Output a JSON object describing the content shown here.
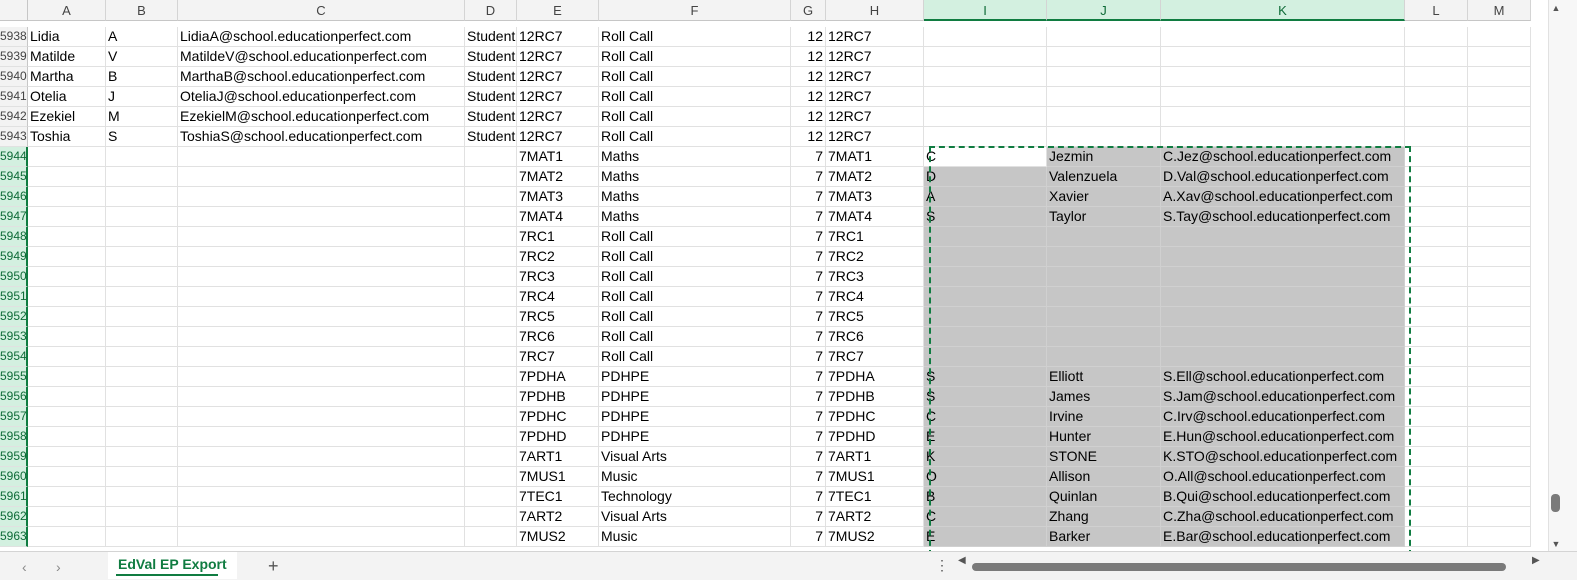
{
  "columns": [
    {
      "letter": "A",
      "width": 78
    },
    {
      "letter": "B",
      "width": 72
    },
    {
      "letter": "C",
      "width": 287
    },
    {
      "letter": "D",
      "width": 52
    },
    {
      "letter": "E",
      "width": 82
    },
    {
      "letter": "F",
      "width": 192
    },
    {
      "letter": "G",
      "width": 35
    },
    {
      "letter": "H",
      "width": 98
    },
    {
      "letter": "I",
      "width": 123
    },
    {
      "letter": "J",
      "width": 114
    },
    {
      "letter": "K",
      "width": 244
    },
    {
      "letter": "L",
      "width": 63
    },
    {
      "letter": "M",
      "width": 63
    }
  ],
  "selected_columns": [
    "I",
    "J",
    "K"
  ],
  "rows": [
    {
      "num": "5938",
      "A": "Lidia",
      "B": "A",
      "C": "LidiaA@school.educationperfect.com",
      "D": "Student",
      "E": "12RC7",
      "F": "Roll Call",
      "G": "12",
      "H": "12RC7",
      "I": "",
      "J": "",
      "K": ""
    },
    {
      "num": "5939",
      "A": "Matilde",
      "B": "V",
      "C": "MatildeV@school.educationperfect.com",
      "D": "Student",
      "E": "12RC7",
      "F": "Roll Call",
      "G": "12",
      "H": "12RC7",
      "I": "",
      "J": "",
      "K": ""
    },
    {
      "num": "5940",
      "A": "Martha",
      "B": "B",
      "C": "MarthaB@school.educationperfect.com",
      "D": "Student",
      "E": "12RC7",
      "F": "Roll Call",
      "G": "12",
      "H": "12RC7",
      "I": "",
      "J": "",
      "K": ""
    },
    {
      "num": "5941",
      "A": "Otelia",
      "B": "J",
      "C": "OteliaJ@school.educationperfect.com",
      "D": "Student",
      "E": "12RC7",
      "F": "Roll Call",
      "G": "12",
      "H": "12RC7",
      "I": "",
      "J": "",
      "K": ""
    },
    {
      "num": "5942",
      "A": "Ezekiel",
      "B": "M",
      "C": "EzekielM@school.educationperfect.com",
      "D": "Student",
      "E": "12RC7",
      "F": "Roll Call",
      "G": "12",
      "H": "12RC7",
      "I": "",
      "J": "",
      "K": ""
    },
    {
      "num": "5943",
      "A": "Toshia",
      "B": "S",
      "C": "ToshiaS@school.educationperfect.com",
      "D": "Student",
      "E": "12RC7",
      "F": "Roll Call",
      "G": "12",
      "H": "12RC7",
      "I": "",
      "J": "",
      "K": ""
    },
    {
      "num": "5944",
      "A": "",
      "B": "",
      "C": "",
      "D": "",
      "E": "7MAT1",
      "F": "Maths",
      "G": "7",
      "H": "7MAT1",
      "I": "C",
      "J": "Jezmin",
      "K": "C.Jez@school.educationperfect.com"
    },
    {
      "num": "5945",
      "A": "",
      "B": "",
      "C": "",
      "D": "",
      "E": "7MAT2",
      "F": "Maths",
      "G": "7",
      "H": "7MAT2",
      "I": "D",
      "J": "Valenzuela",
      "K": "D.Val@school.educationperfect.com"
    },
    {
      "num": "5946",
      "A": "",
      "B": "",
      "C": "",
      "D": "",
      "E": "7MAT3",
      "F": "Maths",
      "G": "7",
      "H": "7MAT3",
      "I": "A",
      "J": "Xavier",
      "K": "A.Xav@school.educationperfect.com"
    },
    {
      "num": "5947",
      "A": "",
      "B": "",
      "C": "",
      "D": "",
      "E": "7MAT4",
      "F": "Maths",
      "G": "7",
      "H": "7MAT4",
      "I": "S",
      "J": "Taylor",
      "K": "S.Tay@school.educationperfect.com"
    },
    {
      "num": "5948",
      "A": "",
      "B": "",
      "C": "",
      "D": "",
      "E": "7RC1",
      "F": "Roll Call",
      "G": "7",
      "H": "7RC1",
      "I": "",
      "J": "",
      "K": ""
    },
    {
      "num": "5949",
      "A": "",
      "B": "",
      "C": "",
      "D": "",
      "E": "7RC2",
      "F": "Roll Call",
      "G": "7",
      "H": "7RC2",
      "I": "",
      "J": "",
      "K": ""
    },
    {
      "num": "5950",
      "A": "",
      "B": "",
      "C": "",
      "D": "",
      "E": "7RC3",
      "F": "Roll Call",
      "G": "7",
      "H": "7RC3",
      "I": "",
      "J": "",
      "K": ""
    },
    {
      "num": "5951",
      "A": "",
      "B": "",
      "C": "",
      "D": "",
      "E": "7RC4",
      "F": "Roll Call",
      "G": "7",
      "H": "7RC4",
      "I": "",
      "J": "",
      "K": ""
    },
    {
      "num": "5952",
      "A": "",
      "B": "",
      "C": "",
      "D": "",
      "E": "7RC5",
      "F": "Roll Call",
      "G": "7",
      "H": "7RC5",
      "I": "",
      "J": "",
      "K": ""
    },
    {
      "num": "5953",
      "A": "",
      "B": "",
      "C": "",
      "D": "",
      "E": "7RC6",
      "F": "Roll Call",
      "G": "7",
      "H": "7RC6",
      "I": "",
      "J": "",
      "K": ""
    },
    {
      "num": "5954",
      "A": "",
      "B": "",
      "C": "",
      "D": "",
      "E": "7RC7",
      "F": "Roll Call",
      "G": "7",
      "H": "7RC7",
      "I": "",
      "J": "",
      "K": ""
    },
    {
      "num": "5955",
      "A": "",
      "B": "",
      "C": "",
      "D": "",
      "E": "7PDHA",
      "F": "PDHPE",
      "G": "7",
      "H": "7PDHA",
      "I": "S",
      "J": "Elliott",
      "K": "S.Ell@school.educationperfect.com"
    },
    {
      "num": "5956",
      "A": "",
      "B": "",
      "C": "",
      "D": "",
      "E": "7PDHB",
      "F": "PDHPE",
      "G": "7",
      "H": "7PDHB",
      "I": "S",
      "J": "James",
      "K": "S.Jam@school.educationperfect.com"
    },
    {
      "num": "5957",
      "A": "",
      "B": "",
      "C": "",
      "D": "",
      "E": "7PDHC",
      "F": "PDHPE",
      "G": "7",
      "H": "7PDHC",
      "I": "C",
      "J": "Irvine",
      "K": "C.Irv@school.educationperfect.com"
    },
    {
      "num": "5958",
      "A": "",
      "B": "",
      "C": "",
      "D": "",
      "E": "7PDHD",
      "F": "PDHPE",
      "G": "7",
      "H": "7PDHD",
      "I": "E",
      "J": "Hunter",
      "K": "E.Hun@school.educationperfect.com"
    },
    {
      "num": "5959",
      "A": "",
      "B": "",
      "C": "",
      "D": "",
      "E": "7ART1",
      "F": "Visual Arts",
      "G": "7",
      "H": "7ART1",
      "I": "K",
      "J": "STONE",
      "K": "K.STO@school.educationperfect.com"
    },
    {
      "num": "5960",
      "A": "",
      "B": "",
      "C": "",
      "D": "",
      "E": "7MUS1",
      "F": "Music",
      "G": "7",
      "H": "7MUS1",
      "I": "O",
      "J": "Allison",
      "K": "O.All@school.educationperfect.com"
    },
    {
      "num": "5961",
      "A": "",
      "B": "",
      "C": "",
      "D": "",
      "E": "7TEC1",
      "F": "Technology",
      "G": "7",
      "H": "7TEC1",
      "I": "B",
      "J": "Quinlan",
      "K": "B.Qui@school.educationperfect.com"
    },
    {
      "num": "5962",
      "A": "",
      "B": "",
      "C": "",
      "D": "",
      "E": "7ART2",
      "F": "Visual Arts",
      "G": "7",
      "H": "7ART2",
      "I": "C",
      "J": "Zhang",
      "K": "C.Zha@school.educationperfect.com"
    },
    {
      "num": "5963",
      "A": "",
      "B": "",
      "C": "",
      "D": "",
      "E": "7MUS2",
      "F": "Music",
      "G": "7",
      "H": "7MUS2",
      "I": "E",
      "J": "Barker",
      "K": "E.Bar@school.educationperfect.com"
    }
  ],
  "sheet_tab": {
    "label": "EdVal EP Export"
  },
  "icons": {
    "nav_prev": "chevron-left-icon",
    "nav_next": "chevron-right-icon",
    "add_sheet": "plus-icon",
    "options": "vertical-dots-icon",
    "scroll_left": "triangle-left-icon",
    "scroll_right": "triangle-right-icon",
    "scroll_up": "triangle-up-icon",
    "scroll_down": "triangle-down-icon"
  },
  "colors": {
    "accent": "#107c41",
    "selection_fill": "#c6c6c6",
    "header_fill": "#f3f3f3"
  }
}
